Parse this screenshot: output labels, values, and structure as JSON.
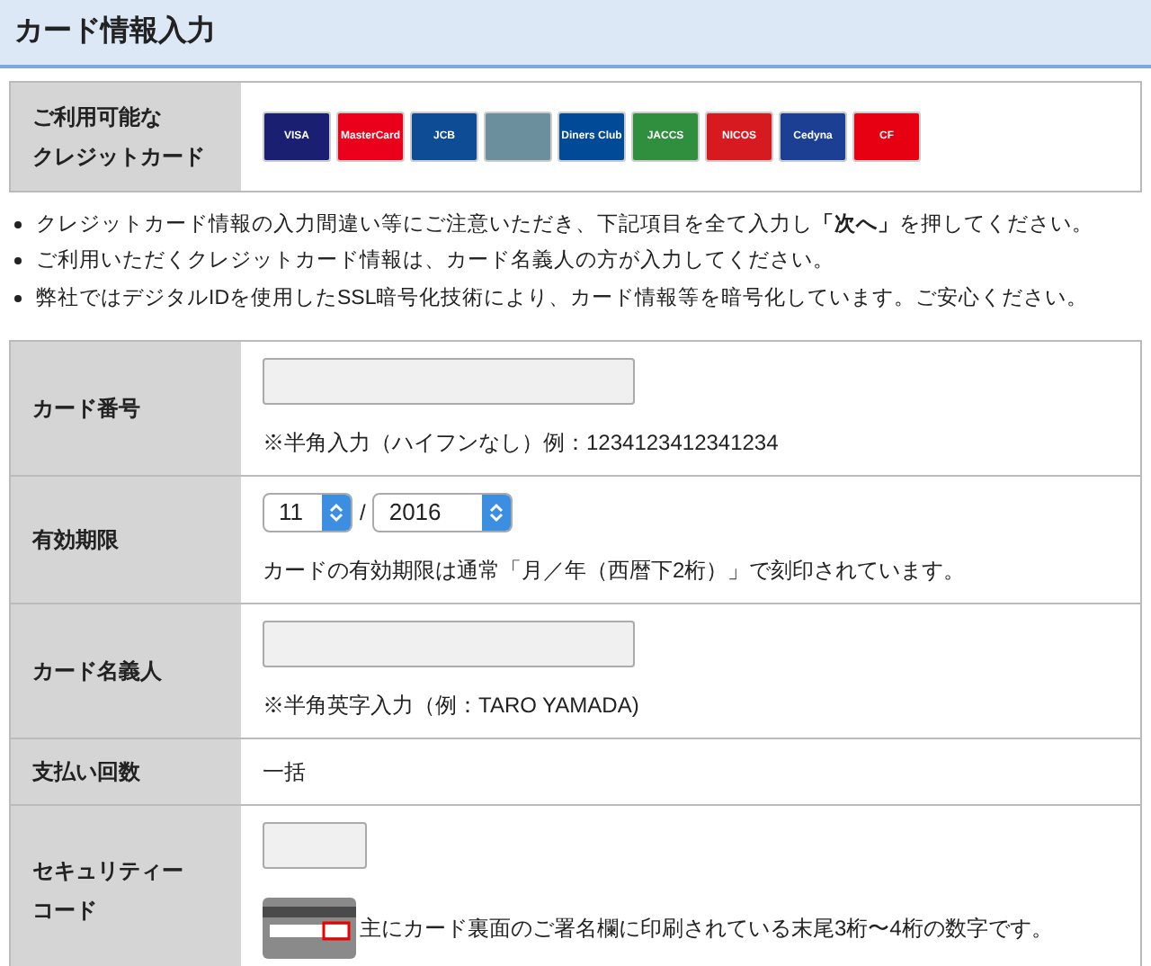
{
  "title": "カード情報入力",
  "cards_label": [
    "ご利用可能な",
    "クレジットカード"
  ],
  "cards": [
    {
      "label": "VISA",
      "color": "#1a1f71"
    },
    {
      "label": "MasterCard",
      "color": "#eb001b"
    },
    {
      "label": "JCB",
      "color": "#0e4c96"
    },
    {
      "color": "#6b8f9c"
    },
    {
      "label": "Diners Club",
      "color": "#004a97"
    },
    {
      "label": "JACCS",
      "color": "#2f8f3f"
    },
    {
      "label": "NICOS",
      "color": "#d71920"
    },
    {
      "label": "Cedyna",
      "color": "#1c3f94"
    },
    {
      "label": "CF",
      "color": "#e60012"
    }
  ],
  "notes": [
    "クレジットカード情報の入力間違い等にご注意いただき、下記項目を全て入力し**「次へ」**を押してください。",
    "ご利用いただくクレジットカード情報は、カード名義人の方が入力してください。",
    "弊社ではデジタルIDを使用したSSL暗号化技術により、カード情報等を暗号化しています。ご安心ください。"
  ],
  "rows": [
    {
      "kind": "input",
      "label": [
        "カード番号"
      ],
      "hint": "※半角入力（ハイフンなし）例：1234123412341234"
    },
    {
      "kind": "expiry",
      "label": [
        "有効期限"
      ],
      "month": "11",
      "separator": "/",
      "year": "2016",
      "hint": "カードの有効期限は通常「月／年（西暦下2桁）」で刻印されています。"
    },
    {
      "kind": "input",
      "label": [
        "カード名義人"
      ],
      "hint": "※半角英字入力（例：TARO YAMADA)"
    },
    {
      "kind": "text",
      "label": [
        "支払い回数"
      ],
      "value": "一括"
    },
    {
      "kind": "security",
      "label": [
        "セキュリティー",
        "コード"
      ],
      "hint": "主にカード裏面のご署名欄に印刷されている末尾3桁〜4桁の数字です。"
    }
  ]
}
